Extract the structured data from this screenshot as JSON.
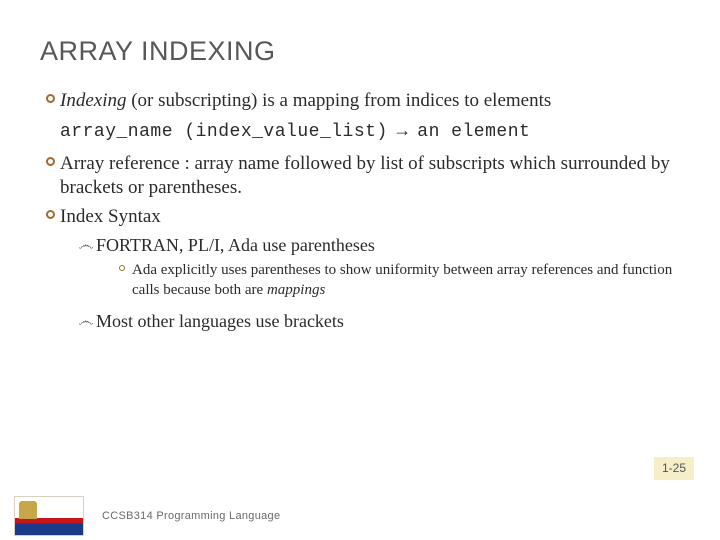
{
  "title": "ARRAY INDEXING",
  "b1": {
    "lead": "Indexing",
    "rest": " (or subscripting) is a mapping from indices to elements"
  },
  "code": {
    "lhs": "array_name (index_value_list)",
    "arrow": " → ",
    "rhs": " an element"
  },
  "b2": "Array reference : array name followed by list of subscripts which surrounded by brackets or parentheses.",
  "b3": "Index Syntax",
  "s1": "FORTRAN, PL/I, Ada use parentheses",
  "ss1": {
    "pre": "Ada explicitly uses parentheses to show uniformity between array references and function calls because both are ",
    "em": "mappings"
  },
  "s2": "Most other languages use brackets",
  "page": "1-25",
  "footer": "CCSB314 Programming Language"
}
